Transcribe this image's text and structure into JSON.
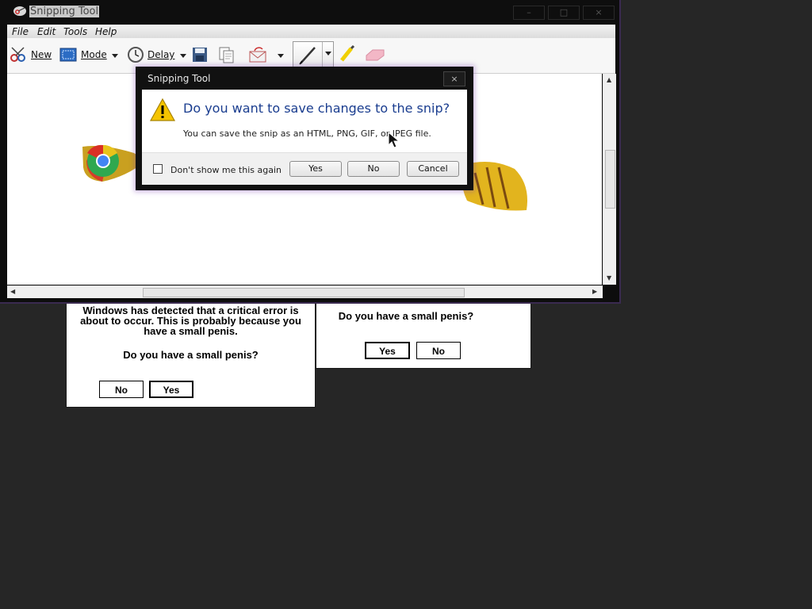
{
  "window": {
    "title": "Snipping Tool",
    "minimize": "–",
    "maximize": "□",
    "close": "×"
  },
  "menu": [
    "File",
    "Edit",
    "Tools",
    "Help"
  ],
  "toolbar": {
    "new_label": "New",
    "mode_label": "Mode",
    "delay_label": "Delay"
  },
  "dialog": {
    "title": "Snipping Tool",
    "close": "×",
    "heading": "Do you want to save changes to the snip?",
    "body": "You can save the snip as an HTML, PNG, GIF, or JPEG file.",
    "checkbox_label": "Don't show me this again",
    "yes": "Yes",
    "no": "No",
    "cancel": "Cancel"
  },
  "popup_left": {
    "message": "Windows has detected that a critical error is about to occur. This is probably because you have a small penis.",
    "question": "Do you have a small penis?",
    "no": "No",
    "yes": "Yes"
  },
  "popup_right": {
    "question": "Do you have a small penis?",
    "yes": "Yes",
    "no": "No"
  },
  "colors": {
    "heading_blue": "#1a3d8f",
    "desktop": "#262626",
    "accent_purple": "#7a3cc8"
  }
}
